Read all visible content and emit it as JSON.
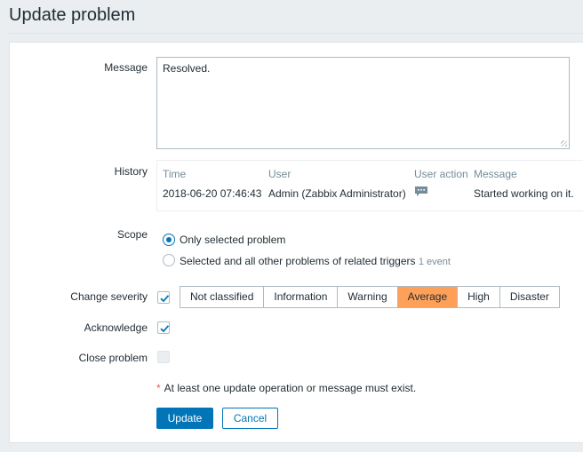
{
  "page_title": "Update problem",
  "message": {
    "label": "Message",
    "value": "Resolved."
  },
  "history": {
    "label": "History",
    "columns": [
      "Time",
      "User",
      "User action",
      "Message"
    ],
    "rows": [
      {
        "time": "2018-06-20 07:46:43",
        "user": "Admin (Zabbix Administrator)",
        "action_icon": "comment-icon",
        "message": "Started working on it."
      }
    ]
  },
  "scope": {
    "label": "Scope",
    "options": [
      {
        "label": "Only selected problem",
        "checked": true
      },
      {
        "label": "Selected and all other problems of related triggers",
        "hint": "1 event",
        "checked": false
      }
    ]
  },
  "change_severity": {
    "label": "Change severity",
    "checked": true,
    "levels": [
      "Not classified",
      "Information",
      "Warning",
      "Average",
      "High",
      "Disaster"
    ],
    "selected": "Average"
  },
  "acknowledge": {
    "label": "Acknowledge",
    "checked": true
  },
  "close_problem": {
    "label": "Close problem",
    "checked": false,
    "disabled": true
  },
  "validation_note": "At least one update operation or message must exist.",
  "buttons": {
    "update": "Update",
    "cancel": "Cancel"
  },
  "colors": {
    "primary": "#0275b8",
    "selected_severity": "#ffa059",
    "required_star": "#e45959"
  }
}
